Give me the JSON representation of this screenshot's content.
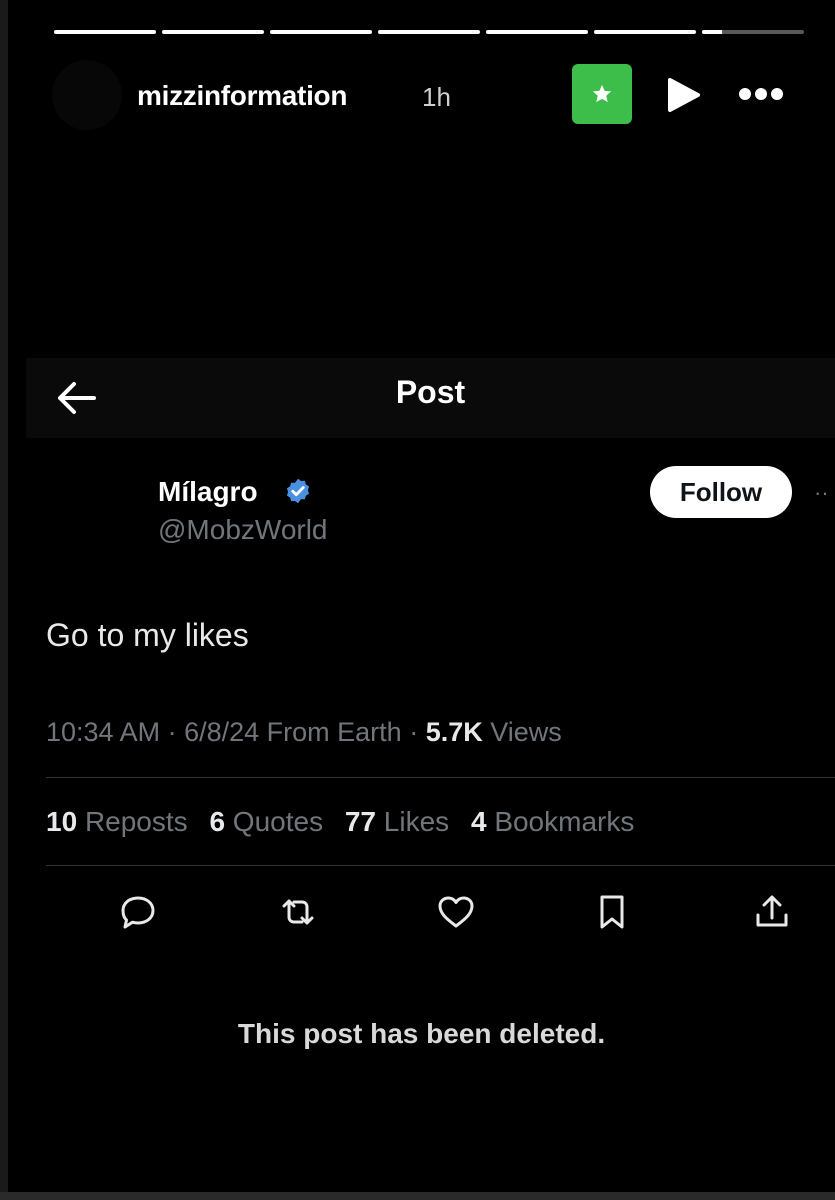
{
  "story": {
    "progress": [
      1,
      1,
      1,
      1,
      1,
      1,
      0.2
    ],
    "username": "mizzinformation",
    "time": "1h",
    "icons": {
      "star": "star-icon",
      "play": "play-icon",
      "more": "more-horizontal-icon"
    },
    "colors": {
      "star_button": "#3dbe4a"
    }
  },
  "post_header": {
    "title": "Post",
    "back_icon": "arrow-left-icon"
  },
  "author": {
    "name": "Mílagro",
    "handle": "@MobzWorld",
    "verified_icon": "verified-badge-icon",
    "verified_color": "#4a90e2",
    "follow_label": "Follow",
    "overflow": "··"
  },
  "post": {
    "text": "Go to my likes"
  },
  "meta": {
    "time": "10:34 AM",
    "sep1": " · ",
    "date": "6/8/24",
    "location": " From Earth",
    "sep2": " · ",
    "views_count": "5.7K",
    "views_label": " Views"
  },
  "stats": [
    {
      "count": "10",
      "label": "Reposts"
    },
    {
      "count": "6",
      "label": "Quotes"
    },
    {
      "count": "77",
      "label": "Likes"
    },
    {
      "count": "4",
      "label": "Bookmarks"
    }
  ],
  "actions": [
    "reply-icon",
    "repost-icon",
    "like-icon",
    "bookmark-icon",
    "share-icon"
  ],
  "deleted_message": "This post has been deleted."
}
